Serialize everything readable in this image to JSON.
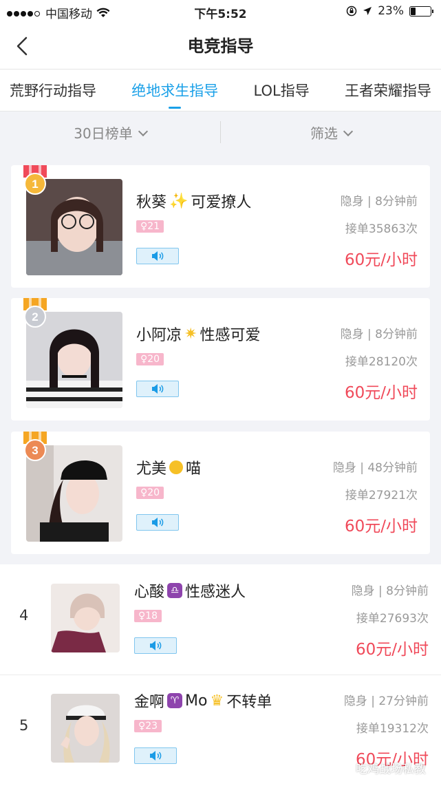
{
  "status_bar": {
    "carrier": "中国移动",
    "time": "下午5:52",
    "battery": "23%",
    "battery_level": 0.23
  },
  "nav": {
    "title": "电竞指导"
  },
  "tabs": [
    {
      "label": "荒野行动指导"
    },
    {
      "label": "绝地求生指导"
    },
    {
      "label": "LOL指导"
    },
    {
      "label": "王者荣耀指导"
    }
  ],
  "filters": {
    "ranking": "30日榜单",
    "filter": "筛选"
  },
  "top_cards": [
    {
      "rank": "1",
      "name": "秋葵",
      "tagline": "可爱撩人",
      "emoji_icon": "sparkles-icon",
      "age": "♀21",
      "status": "隐身 | 8分钟前",
      "orders": "接单35863次",
      "price": "60元/小时",
      "ribbon_color": "#f5b83a"
    },
    {
      "rank": "2",
      "name": "小阿凉",
      "tagline": "性感可爱",
      "emoji_icon": "star-icon",
      "age": "♀20",
      "status": "隐身 | 8分钟前",
      "orders": "接单28120次",
      "price": "60元/小时",
      "ribbon_color": "#c8cbd2"
    },
    {
      "rank": "3",
      "name": "尤美",
      "tagline": "喵",
      "emoji_icon": "chick-icon",
      "age": "♀20",
      "status": "隐身 | 48分钟前",
      "orders": "接单27921次",
      "price": "60元/小时",
      "ribbon_color": "#ec8a55"
    }
  ],
  "list_rows": [
    {
      "rank": "4",
      "name": "心酸",
      "tagline": "性感迷人",
      "emoji_icon": "libra-icon",
      "age": "♀18",
      "status": "隐身 | 8分钟前",
      "orders": "接单27693次",
      "price": "60元/小时"
    },
    {
      "rank": "5",
      "name": "金啊",
      "tagline": "Mo",
      "tagline2": "不转单",
      "emoji_icon": "aries-icon",
      "emoji_icon2": "crown-icon",
      "age": "♀23",
      "status": "隐身 | 27分钟前",
      "orders": "接单19312次",
      "price": "60元/小时"
    }
  ],
  "watermark": "吃鸡战场私教"
}
